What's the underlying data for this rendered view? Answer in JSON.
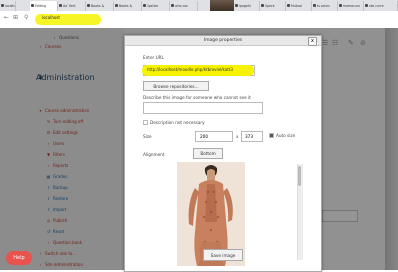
{
  "browser": {
    "tabs": [
      {
        "label": "localhos"
      },
      {
        "label": "Editing"
      },
      {
        "label": "Aa' flert"
      },
      {
        "label": "Books &"
      },
      {
        "label": "Books &"
      },
      {
        "label": "lipstick"
      },
      {
        "label": "who coc"
      },
      {
        "label": "lpagefu"
      },
      {
        "label": "Speck"
      },
      {
        "label": "Mutual"
      },
      {
        "label": "ts amzn"
      },
      {
        "label": "mamacurs"
      },
      {
        "label": "ntb curre"
      }
    ],
    "url": "localhost"
  },
  "sidebar": {
    "questions": "Questions",
    "courses": "Courses",
    "administration": "Administration",
    "course_admin": "Course administration",
    "items": [
      {
        "label": "Turn editing off",
        "icon": "pencil-icon"
      },
      {
        "label": "Edit settings",
        "icon": "gear-icon"
      },
      {
        "label": "Users",
        "icon": "chevron-icon"
      },
      {
        "label": "Filters",
        "icon": "filter-icon"
      },
      {
        "label": "Reports",
        "icon": "chevron-icon"
      },
      {
        "label": "Grades",
        "icon": "grid-icon"
      },
      {
        "label": "Backup",
        "icon": "upload-icon"
      },
      {
        "label": "Restore",
        "icon": "upload-icon"
      },
      {
        "label": "Import",
        "icon": "upload-icon"
      },
      {
        "label": "Publish",
        "icon": "globe-icon"
      },
      {
        "label": "Reset",
        "icon": "reset-icon"
      },
      {
        "label": "Question bank",
        "icon": "chevron-icon"
      }
    ],
    "switch_role": "Switch role to...",
    "site_admin": "Site administration"
  },
  "help_label": "Help",
  "dialog": {
    "title": "Image properties",
    "close_glyph": "x",
    "enter_url_label": "Enter URL",
    "url_value": "http://localhost/moodle.php/ktbroviel/katt3",
    "browse_label": "Browse repositories...",
    "describe_label": "Describe this image for someone who cannot see it",
    "description_not_necessary": "Description not necessary",
    "size_label": "Size",
    "width_value": "200",
    "times": "x",
    "height_value": "373",
    "auto_size_label": "Auto size",
    "alignment_label": "Alignment",
    "alignment_value": "Bottom",
    "save_label": "Save image"
  },
  "colors": {
    "highlight": "#f6f200",
    "accent_red": "#c0392b",
    "link_blue": "#1d6aa8",
    "help_bg": "#e9534e"
  }
}
